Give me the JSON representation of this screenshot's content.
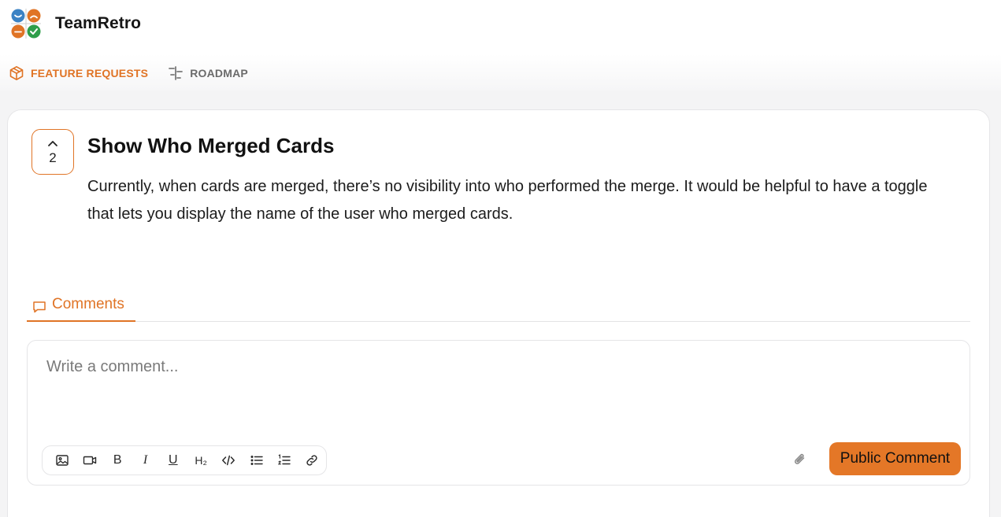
{
  "app": {
    "name": "TeamRetro",
    "logo_colors": [
      "#3b82c4",
      "#e07426",
      "#e07426",
      "#2e9e4a"
    ]
  },
  "nav": {
    "items": [
      {
        "label": "FEATURE REQUESTS",
        "icon": "box-icon",
        "active": true
      },
      {
        "label": "ROADMAP",
        "icon": "roadmap-icon",
        "active": false
      }
    ]
  },
  "post": {
    "vote_count": "2",
    "title": "Show Who Merged Cards",
    "description": "Currently, when cards are merged, there’s no visibility into who performed the merge. It would be helpful to have a toggle that lets you display the name of the user who merged cards."
  },
  "comments": {
    "tab_label": "Comments",
    "placeholder": "Write a comment...",
    "toolbar": [
      {
        "name": "image-icon"
      },
      {
        "name": "video-icon"
      },
      {
        "name": "bold-icon",
        "text": "B"
      },
      {
        "name": "italic-icon",
        "text": "I"
      },
      {
        "name": "underline-icon",
        "text": "U"
      },
      {
        "name": "heading-icon",
        "text": "H₂"
      },
      {
        "name": "code-icon"
      },
      {
        "name": "bullet-list-icon"
      },
      {
        "name": "numbered-list-icon"
      },
      {
        "name": "link-icon"
      }
    ],
    "submit_label": "Public Comment"
  },
  "colors": {
    "accent": "#e07426",
    "button": "#e47727"
  }
}
